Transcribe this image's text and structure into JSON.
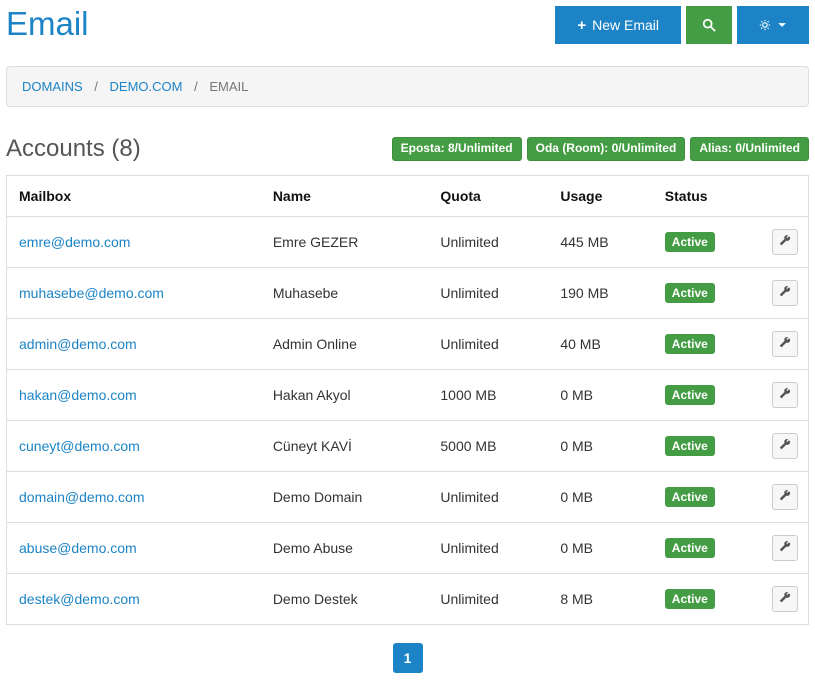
{
  "header": {
    "title": "Email",
    "new_email_label": "New Email"
  },
  "breadcrumb": {
    "domains": "DOMAINS",
    "domain": "DEMO.COM",
    "current": "EMAIL"
  },
  "section": {
    "title": "Accounts (8)"
  },
  "badges": {
    "eposta": "Eposta: 8/Unlimited",
    "oda": "Oda (Room): 0/Unlimited",
    "alias": "Alias: 0/Unlimited"
  },
  "columns": {
    "mailbox": "Mailbox",
    "name": "Name",
    "quota": "Quota",
    "usage": "Usage",
    "status": "Status"
  },
  "status_active": "Active",
  "rows": [
    {
      "mailbox": "emre@demo.com",
      "name": "Emre GEZER",
      "quota": "Unlimited",
      "usage": "445 MB"
    },
    {
      "mailbox": "muhasebe@demo.com",
      "name": "Muhasebe",
      "quota": "Unlimited",
      "usage": "190 MB"
    },
    {
      "mailbox": "admin@demo.com",
      "name": "Admin Online",
      "quota": "Unlimited",
      "usage": "40 MB"
    },
    {
      "mailbox": "hakan@demo.com",
      "name": "Hakan Akyol",
      "quota": "1000 MB",
      "usage": "0 MB"
    },
    {
      "mailbox": "cuneyt@demo.com",
      "name": "Cüneyt KAVİ",
      "quota": "5000 MB",
      "usage": "0 MB"
    },
    {
      "mailbox": "domain@demo.com",
      "name": "Demo Domain",
      "quota": "Unlimited",
      "usage": "0 MB"
    },
    {
      "mailbox": "abuse@demo.com",
      "name": "Demo Abuse",
      "quota": "Unlimited",
      "usage": "0 MB"
    },
    {
      "mailbox": "destek@demo.com",
      "name": "Demo Destek",
      "quota": "Unlimited",
      "usage": "8 MB"
    }
  ],
  "pagination": {
    "current": "1"
  }
}
